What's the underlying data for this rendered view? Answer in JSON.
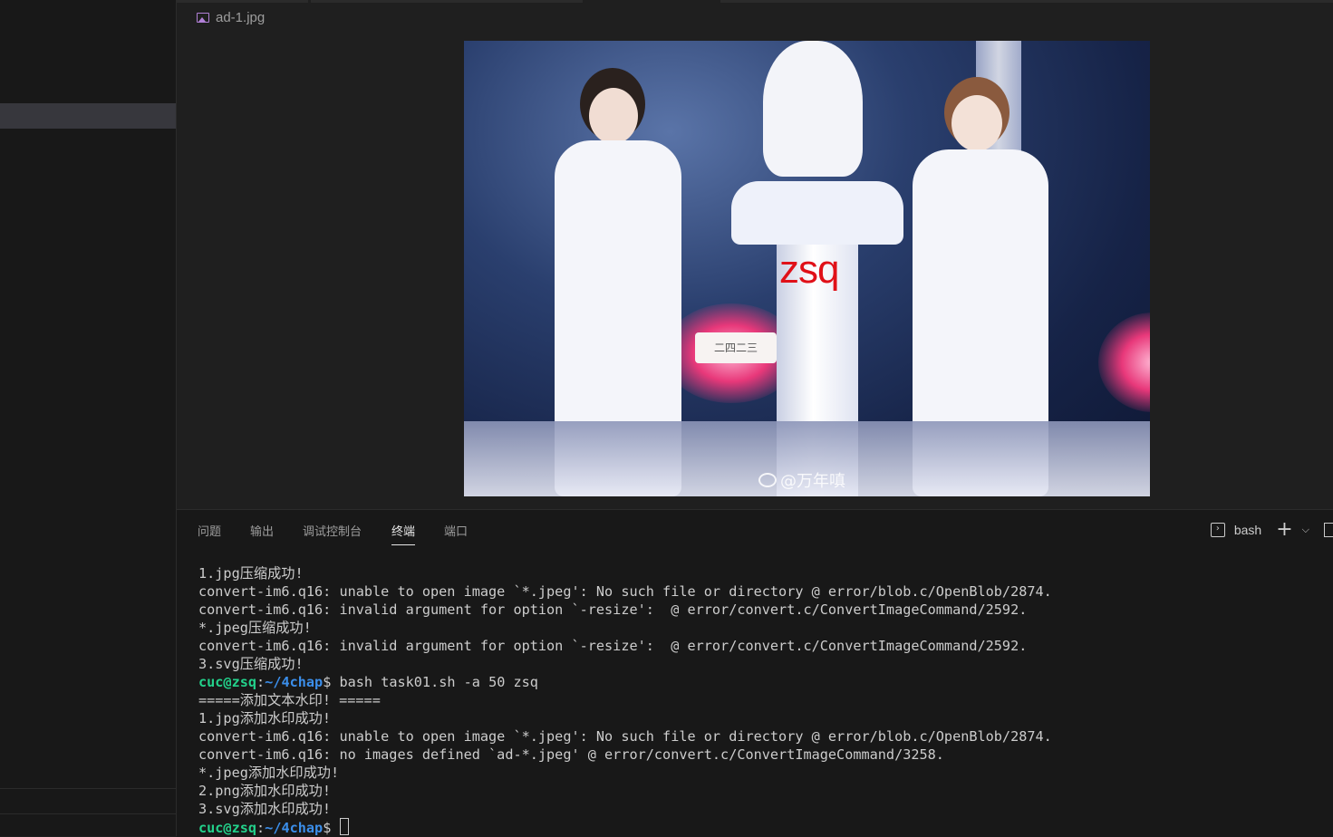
{
  "editor": {
    "tab_title": "ad-1.jpg",
    "image": {
      "watermark_text": "zsq",
      "weibo_handle": "@万年嗔",
      "sign_text": "二四二三"
    }
  },
  "panel": {
    "tabs": [
      {
        "label": "问题"
      },
      {
        "label": "输出"
      },
      {
        "label": "调试控制台"
      },
      {
        "label": "终端"
      },
      {
        "label": "端口"
      }
    ],
    "active_tab": "终端",
    "shell_label": "bash"
  },
  "terminal": {
    "prompt_user": "cuc@zsq",
    "prompt_path": "~/4chap",
    "lines": [
      {
        "text": "1.jpg压缩成功!"
      },
      {
        "text": "convert-im6.q16: unable to open image `*.jpeg': No such file or directory @ error/blob.c/OpenBlob/2874."
      },
      {
        "text": "convert-im6.q16: invalid argument for option `-resize':  @ error/convert.c/ConvertImageCommand/2592."
      },
      {
        "text": "*.jpeg压缩成功!"
      },
      {
        "text": "convert-im6.q16: invalid argument for option `-resize':  @ error/convert.c/ConvertImageCommand/2592."
      },
      {
        "text": "3.svg压缩成功!"
      },
      {
        "text": "bash task01.sh -a 50 zsq",
        "prompt": true
      },
      {
        "text": "=====添加文本水印! ====="
      },
      {
        "text": "1.jpg添加水印成功!"
      },
      {
        "text": "convert-im6.q16: unable to open image `*.jpeg': No such file or directory @ error/blob.c/OpenBlob/2874."
      },
      {
        "text": "convert-im6.q16: no images defined `ad-*.jpeg' @ error/convert.c/ConvertImageCommand/3258."
      },
      {
        "text": "*.jpeg添加水印成功!"
      },
      {
        "text": "2.png添加水印成功!"
      },
      {
        "text": "3.svg添加水印成功!"
      },
      {
        "text": "",
        "prompt": true,
        "cursor": true
      }
    ]
  }
}
